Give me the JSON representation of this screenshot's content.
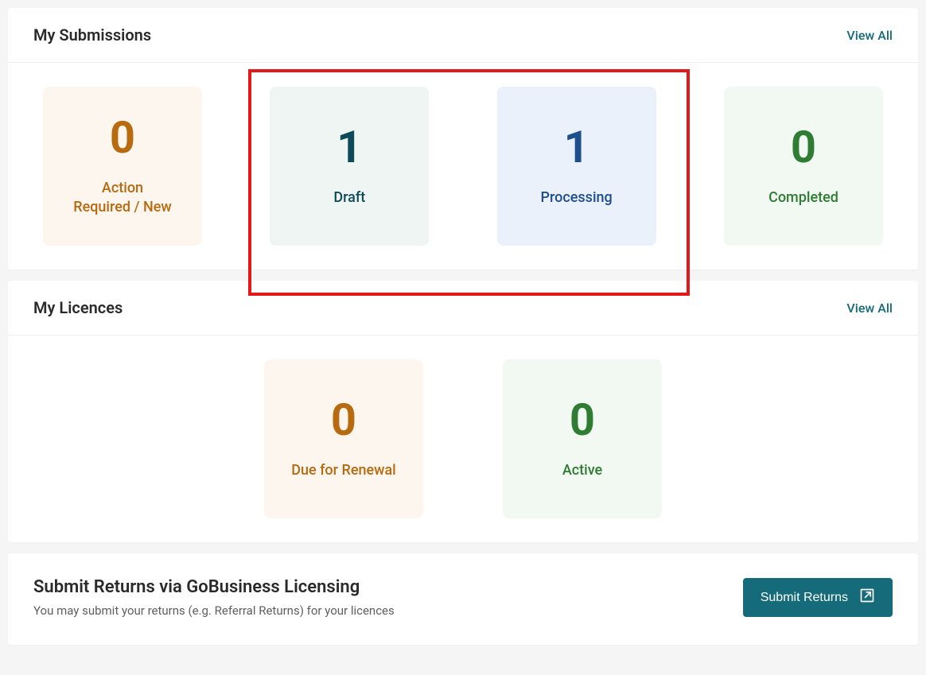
{
  "submissions": {
    "title": "My Submissions",
    "view_all": "View All",
    "tiles": {
      "action": {
        "count": "0",
        "label": "Action\nRequired / New"
      },
      "draft": {
        "count": "1",
        "label": "Draft"
      },
      "processing": {
        "count": "1",
        "label": "Processing"
      },
      "completed": {
        "count": "0",
        "label": "Completed"
      }
    }
  },
  "licences": {
    "title": "My Licences",
    "view_all": "View All",
    "tiles": {
      "renewal": {
        "count": "0",
        "label": "Due for Renewal"
      },
      "active": {
        "count": "0",
        "label": "Active"
      }
    }
  },
  "returns": {
    "title": "Submit Returns via GoBusiness Licensing",
    "description": "You may submit your returns (e.g. Referral Returns) for your licences",
    "button": "Submit Returns"
  }
}
